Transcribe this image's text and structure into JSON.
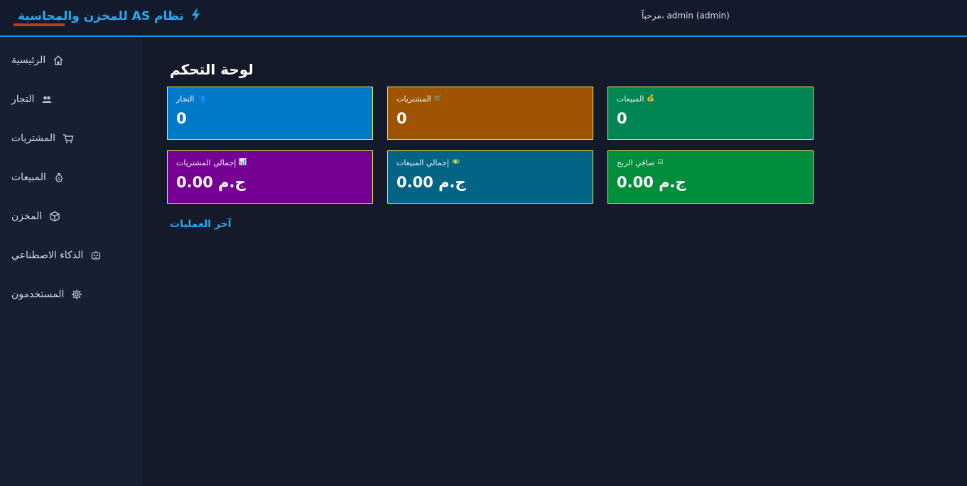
{
  "header": {
    "app_title": "نظام AS للمخزن والمحاسبة",
    "welcome": "مرحباً، admin (admin)",
    "brand_icon": "bolt-icon",
    "accent_color": "#2ba8ee"
  },
  "sidebar": {
    "items": [
      {
        "label": "الرئيسية",
        "icon": "home-icon"
      },
      {
        "label": "التجار",
        "icon": "users-icon"
      },
      {
        "label": "المشتريات",
        "icon": "cart-icon"
      },
      {
        "label": "المبيعات",
        "icon": "money-bag-icon"
      },
      {
        "label": "المخزن",
        "icon": "box-icon"
      },
      {
        "label": "الذكاء الاصطناعي",
        "icon": "robot-icon"
      },
      {
        "label": "المستخدمون",
        "icon": "gear-icon"
      }
    ]
  },
  "main": {
    "title": "لوحة التحكم",
    "cards": [
      {
        "label": "التجار",
        "icon": "users-icon",
        "value": "0",
        "color": "#0079c8"
      },
      {
        "label": "المشتريات",
        "icon": "cart-icon",
        "value": "0",
        "color": "#9e5400"
      },
      {
        "label": "المبيعات",
        "icon": "money-bag-icon",
        "value": "0",
        "color": "#008653"
      },
      {
        "label": "إجمالي المشتريات",
        "icon": "chart-icon",
        "value": "0.00 ج.م",
        "color": "#770094"
      },
      {
        "label": "إجمالي المبيعات",
        "icon": "cash-icon",
        "value": "0.00 ج.م",
        "color": "#036486"
      },
      {
        "label": "صافي الربح",
        "icon": "check-icon",
        "value": "0.00 ج.م",
        "color": "#008e3c"
      }
    ],
    "recent_label": "آخر العمليات"
  }
}
